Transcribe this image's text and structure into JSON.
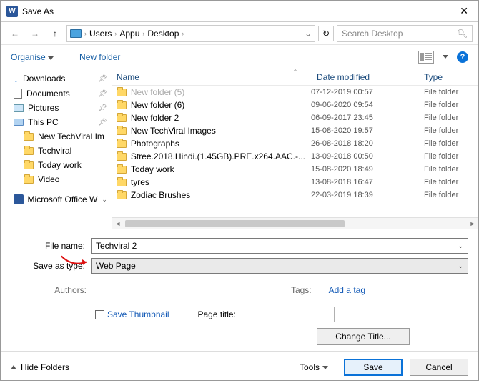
{
  "title": "Save As",
  "breadcrumbs": [
    "Users",
    "Appu",
    "Desktop"
  ],
  "search_placeholder": "Search Desktop",
  "toolbar": {
    "organise": "Organise",
    "newfolder": "New folder"
  },
  "sidebar": {
    "items": [
      {
        "label": "Downloads",
        "pinned": true
      },
      {
        "label": "Documents",
        "pinned": true
      },
      {
        "label": "Pictures",
        "pinned": true
      },
      {
        "label": "This PC",
        "pinned": true
      },
      {
        "label": "New TechViral Im"
      },
      {
        "label": "Techviral"
      },
      {
        "label": "Today work"
      },
      {
        "label": "Video"
      }
    ],
    "footer": "Microsoft Office W"
  },
  "columns": {
    "name": "Name",
    "date": "Date modified",
    "type": "Type"
  },
  "rows": [
    {
      "name": "New folder (5)",
      "date": "07-12-2019 00:57",
      "type": "File folder",
      "faded": true
    },
    {
      "name": "New folder (6)",
      "date": "09-06-2020 09:54",
      "type": "File folder"
    },
    {
      "name": "New folder 2",
      "date": "06-09-2017 23:45",
      "type": "File folder"
    },
    {
      "name": "New TechViral Images",
      "date": "15-08-2020 19:57",
      "type": "File folder"
    },
    {
      "name": "Photographs",
      "date": "26-08-2018 18:20",
      "type": "File folder"
    },
    {
      "name": "Stree.2018.Hindi.(1.45GB).PRE.x264.AAC.-...",
      "date": "13-09-2018 00:50",
      "type": "File folder"
    },
    {
      "name": "Today work",
      "date": "15-08-2020 18:49",
      "type": "File folder"
    },
    {
      "name": "tyres",
      "date": "13-08-2018 16:47",
      "type": "File folder"
    },
    {
      "name": "Zodiac Brushes",
      "date": "22-03-2019 18:39",
      "type": "File folder"
    }
  ],
  "form": {
    "filename_label": "File name:",
    "filename_value": "Techviral 2",
    "type_label": "Save as type:",
    "type_value": "Web Page",
    "authors_label": "Authors:",
    "tags_label": "Tags:",
    "addtag": "Add a tag",
    "save_thumbnail": "Save Thumbnail",
    "page_title_label": "Page title:",
    "change_title": "Change Title..."
  },
  "footer": {
    "hide_folders": "Hide Folders",
    "tools": "Tools",
    "save": "Save",
    "cancel": "Cancel"
  }
}
